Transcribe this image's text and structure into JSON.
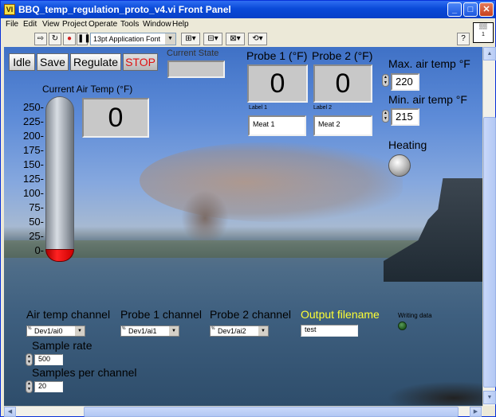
{
  "window": {
    "title": "BBQ_temp_regulation_proto_v4.vi Front Panel",
    "minimize": "_",
    "maximize": "□",
    "close": "✕",
    "icon_text": "VI"
  },
  "menu": [
    "File",
    "Edit",
    "View",
    "Project",
    "Operate",
    "Tools",
    "Window",
    "Help"
  ],
  "toolbar": {
    "font": "13pt Application Font",
    "help": "?"
  },
  "vi_icon": {
    "top": "▒▒",
    "bottom": "1"
  },
  "panel": {
    "buttons": {
      "idle": "Idle",
      "save": "Save",
      "regulate": "Regulate",
      "stop": "STOP"
    },
    "current_state": {
      "label": "Current State",
      "value": ""
    },
    "probe1": {
      "label": "Probe 1 (°F)",
      "value": "0",
      "text_label": "Label 1",
      "text_value": "Meat 1"
    },
    "probe2": {
      "label": "Probe 2 (°F)",
      "value": "0",
      "text_label": "Label 2",
      "text_value": "Meat 2"
    },
    "max_air": {
      "label": "Max. air temp °F",
      "value": "220"
    },
    "min_air": {
      "label": "Min. air temp °F",
      "value": "215"
    },
    "heating": {
      "label": "Heating",
      "on": false
    },
    "air_temp": {
      "label": "Current Air Temp (°F)",
      "value": "0",
      "scale_min": 0,
      "scale_max": 250,
      "ticks": [
        "250-",
        "225-",
        "200-",
        "175-",
        "150-",
        "125-",
        "100-",
        "75-",
        "50-",
        "25-",
        "0-"
      ],
      "level": 0
    },
    "channels": {
      "air_label": "Air temp channel",
      "air_value": "Dev1/ai0",
      "probe1_label": "Probe 1 channel",
      "probe1_value": "Dev1/ai1",
      "probe2_label": "Probe 2 channel",
      "probe2_value": "Dev1/ai2"
    },
    "output": {
      "label": "Output filename",
      "value": "test"
    },
    "writing": {
      "label": "Writing data",
      "on": false
    },
    "sample_rate": {
      "label": "Sample rate",
      "value": "500"
    },
    "samples_per_channel": {
      "label": "Samples per channel",
      "value": "20"
    }
  },
  "colors": {
    "stop_text": "#e01010",
    "output_label": "#ffff33",
    "heating_led": "#c8c8c8",
    "writing_led": "#1f5a1f"
  }
}
